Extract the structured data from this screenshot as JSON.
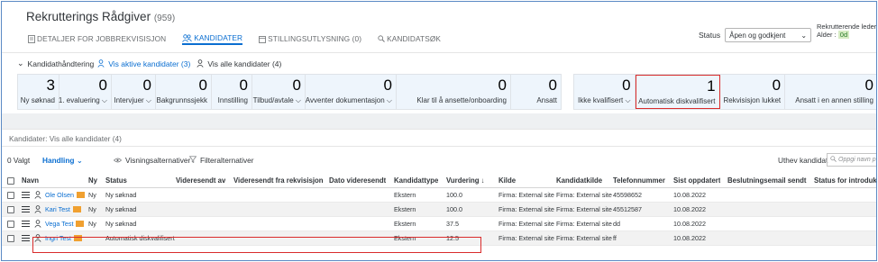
{
  "header": {
    "title": "Rekrutterings Rådgiver",
    "count": "(959)",
    "tabs": [
      {
        "label": "DETALJER FOR JOBBREKVISISJON",
        "icon": "document-icon"
      },
      {
        "label": "KANDIDATER",
        "icon": "people-icon",
        "active": true
      },
      {
        "label": "STILLINGSUTLYSNING (0)",
        "icon": "calendar-icon"
      },
      {
        "label": "KANDIDATSØK",
        "icon": "search-icon"
      }
    ],
    "status_label": "Status",
    "status_value": "Åpen og godkjent",
    "recruiting_lead_label": "Rekrutterende leder :",
    "age_label": "Alder :",
    "age_value": "0d"
  },
  "candidate_handling": {
    "title": "Kandidathåndtering",
    "active_link": "Vis aktive kandidater (3)",
    "all_label": "Vis alle kandidater (4)"
  },
  "tiles_left": [
    {
      "num": "3",
      "label": "Ny søknad"
    },
    {
      "num": "0",
      "label": "1. evaluering ⌵"
    },
    {
      "num": "0",
      "label": "Intervjuer ⌵"
    },
    {
      "num": "0",
      "label": "Bakgrunnssjekk"
    },
    {
      "num": "0",
      "label": "Innstilling"
    },
    {
      "num": "0",
      "label": "Tilbud/avtale ⌵"
    },
    {
      "num": "0",
      "label": "Avventer dokumentasjon ⌵"
    },
    {
      "num": "0",
      "label": "Klar til å ansette/onboarding"
    },
    {
      "num": "0",
      "label": "Ansatt"
    }
  ],
  "tiles_right": [
    {
      "num": "0",
      "label": "Ikke kvalifisert ⌵"
    },
    {
      "num": "1",
      "label": "Automatisk diskvalifisert"
    },
    {
      "num": "0",
      "label": "Rekvisisjon lukket"
    },
    {
      "num": "0",
      "label": "Ansatt i en annen stilling"
    }
  ],
  "candidates_label": "Kandidater: Vis alle kandidater (4)",
  "toolbar": {
    "selected": "0 Valgt",
    "handling": "Handling",
    "view_options": "Visningsalternativer",
    "filter_options": "Filteralternativer",
    "highlight": "Uthev kandidat",
    "search_placeholder": "Oppgi navn p"
  },
  "table": {
    "headers": [
      "Navn",
      "Ny",
      "Status",
      "Videresendt av",
      "Videresendt fra rekvisisjon",
      "Dato videresendt",
      "Kandidattype",
      "Vurdering ↓",
      "Kilde",
      "Kandidatkilde",
      "Telefonnummer",
      "Sist oppdatert",
      "Beslutningsemail sendt",
      "Status for introduks"
    ],
    "rows": [
      {
        "name": "Ole Olsen",
        "ny": "Ny",
        "status": "Ny søknad",
        "type": "Ekstern",
        "score": "100.0",
        "source": "Firma: External site",
        "cand_source": "Firma: External site",
        "phone": "45598652",
        "updated": "10.08.2022"
      },
      {
        "name": "Kari Test",
        "ny": "Ny",
        "status": "Ny søknad",
        "type": "Ekstern",
        "score": "100.0",
        "source": "Firma: External site",
        "cand_source": "Firma: External site",
        "phone": "45512587",
        "updated": "10.08.2022"
      },
      {
        "name": "Vega Test",
        "ny": "Ny",
        "status": "Ny søknad",
        "type": "Ekstern",
        "score": "37.5",
        "source": "Firma: External site",
        "cand_source": "Firma: External site",
        "phone": "dd",
        "updated": "10.08.2022"
      },
      {
        "name": "Ingri Test",
        "ny": "",
        "status": "Automatisk diskvalifisert",
        "type": "Ekstern",
        "score": "12.5",
        "source": "Firma: External site",
        "cand_source": "Firma: External site",
        "phone": "ff",
        "updated": "10.08.2022"
      }
    ]
  },
  "colors": {
    "accent": "#0a6ed1",
    "highlight_red": "#d92c2c",
    "tile_bg": "#eef5fc",
    "flag": "#f0a030"
  }
}
